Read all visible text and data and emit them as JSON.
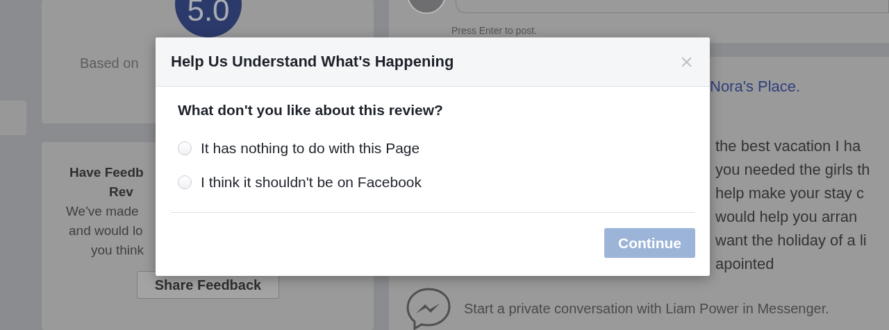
{
  "background": {
    "rating_card": {
      "score": "5.0",
      "caption": "Based on"
    },
    "feedback_card": {
      "title_lines": [
        "Have Feedb",
        "Rev"
      ],
      "body_lines": [
        "We've made",
        "and would lo",
        "you think"
      ],
      "button": "Share Feedback"
    },
    "composer": {
      "hint": "Press Enter to post."
    },
    "review": {
      "page_link": "Nora's Place.",
      "lines": [
        "the best vacation I ha",
        "you needed the girls th",
        "help make your stay c",
        "would help you arran",
        "want the holiday of a li",
        "apointed"
      ]
    },
    "messenger_prompt": "Start a private conversation with Liam Power in Messenger."
  },
  "dialog": {
    "title": "Help Us Understand What's Happening",
    "close": "×",
    "question": "What don't you like about this review?",
    "options": [
      {
        "label": "It has nothing to do with this Page",
        "selected": false
      },
      {
        "label": "I think it shouldn't be on Facebook",
        "selected": false
      }
    ],
    "continue_button": {
      "label": "Continue",
      "disabled": true
    }
  }
}
